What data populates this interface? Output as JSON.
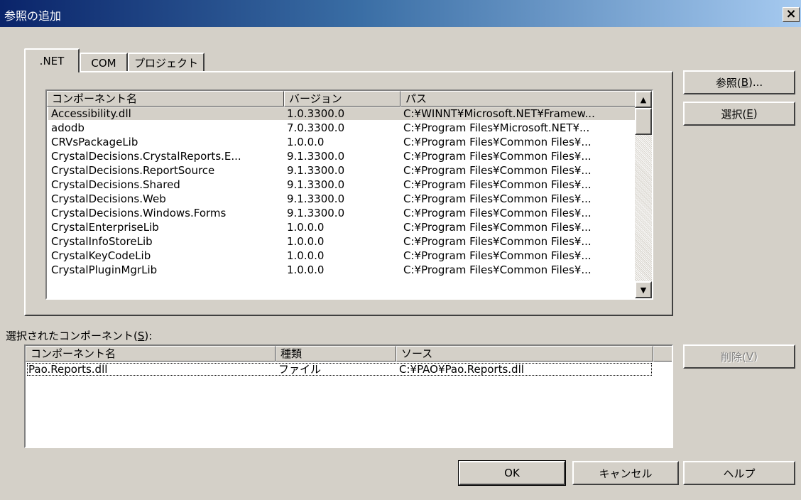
{
  "window": {
    "title": "参照の追加",
    "close_glyph": "×"
  },
  "tabs": [
    {
      "label": ".NET"
    },
    {
      "label": "COM"
    },
    {
      "label": "プロジェクト"
    }
  ],
  "components": {
    "columns": [
      "コンポーネント名",
      "バージョン",
      "パス"
    ],
    "rows": [
      {
        "name": "Accessibility.dll",
        "version": "1.0.3300.0",
        "path": "C:¥WINNT¥Microsoft.NET¥Framew..."
      },
      {
        "name": "adodb",
        "version": "7.0.3300.0",
        "path": "C:¥Program Files¥Microsoft.NET¥..."
      },
      {
        "name": "CRVsPackageLib",
        "version": "1.0.0.0",
        "path": "C:¥Program Files¥Common Files¥..."
      },
      {
        "name": "CrystalDecisions.CrystalReports.E...",
        "version": "9.1.3300.0",
        "path": "C:¥Program Files¥Common Files¥..."
      },
      {
        "name": "CrystalDecisions.ReportSource",
        "version": "9.1.3300.0",
        "path": "C:¥Program Files¥Common Files¥..."
      },
      {
        "name": "CrystalDecisions.Shared",
        "version": "9.1.3300.0",
        "path": "C:¥Program Files¥Common Files¥..."
      },
      {
        "name": "CrystalDecisions.Web",
        "version": "9.1.3300.0",
        "path": "C:¥Program Files¥Common Files¥..."
      },
      {
        "name": "CrystalDecisions.Windows.Forms",
        "version": "9.1.3300.0",
        "path": "C:¥Program Files¥Common Files¥..."
      },
      {
        "name": "CrystalEnterpriseLib",
        "version": "1.0.0.0",
        "path": "C:¥Program Files¥Common Files¥..."
      },
      {
        "name": "CrystalInfoStoreLib",
        "version": "1.0.0.0",
        "path": "C:¥Program Files¥Common Files¥..."
      },
      {
        "name": "CrystalKeyCodeLib",
        "version": "1.0.0.0",
        "path": "C:¥Program Files¥Common Files¥..."
      },
      {
        "name": "CrystalPluginMgrLib",
        "version": "1.0.0.0",
        "path": "C:¥Program Files¥Common Files¥..."
      }
    ]
  },
  "buttons": {
    "browse": {
      "label": "参照(",
      "key": "B",
      "suffix": ")..."
    },
    "select": {
      "label": "選択(",
      "key": "E",
      "suffix": ")"
    },
    "remove": {
      "label": "削除(",
      "key": "V",
      "suffix": ")"
    },
    "ok": "OK",
    "cancel": "キャンセル",
    "help": "ヘルプ"
  },
  "selected": {
    "label": "選択されたコンポーネント(",
    "label_key": "S",
    "label_suffix": "):",
    "columns": [
      "コンポーネント名",
      "種類",
      "ソース"
    ],
    "rows": [
      {
        "name": "Pao.Reports.dll",
        "type": "ファイル",
        "source": "C:¥PAO¥Pao.Reports.dll"
      }
    ]
  },
  "colors": {
    "face": "#d4d0c8",
    "title_start": "#0a246a",
    "title_end": "#a6caf0",
    "selection": "#d4d0c8"
  }
}
